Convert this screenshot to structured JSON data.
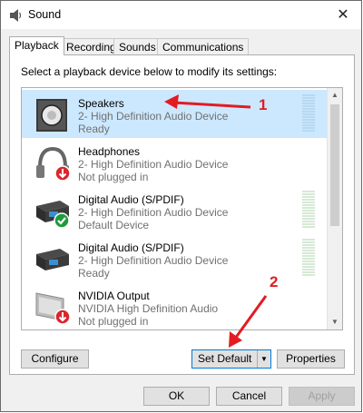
{
  "window": {
    "title": "Sound",
    "close_label": "✕"
  },
  "tabs": [
    {
      "label": "Playback"
    },
    {
      "label": "Recording"
    },
    {
      "label": "Sounds"
    },
    {
      "label": "Communications"
    }
  ],
  "instructions": "Select a playback device below to modify its settings:",
  "devices": [
    {
      "name": "Speakers",
      "desc": "2- High Definition Audio Device",
      "status": "Ready",
      "icon": "speaker-icon",
      "selected": true
    },
    {
      "name": "Headphones",
      "desc": "2- High Definition Audio Device",
      "status": "Not plugged in",
      "icon": "headphones-icon",
      "badge": "down-arrow-badge"
    },
    {
      "name": "Digital Audio (S/PDIF)",
      "desc": "2- High Definition Audio Device",
      "status": "Default Device",
      "icon": "digital-audio-icon",
      "badge": "checkmark-badge"
    },
    {
      "name": "Digital Audio (S/PDIF)",
      "desc": "2- High Definition Audio Device",
      "status": "Ready",
      "icon": "digital-audio-icon"
    },
    {
      "name": "NVIDIA Output",
      "desc": "NVIDIA High Definition Audio",
      "status": "Not plugged in",
      "icon": "monitor-icon",
      "badge": "down-arrow-badge"
    }
  ],
  "buttons": {
    "configure": "Configure",
    "set_default": "Set Default",
    "properties": "Properties",
    "ok": "OK",
    "cancel": "Cancel",
    "apply": "Apply"
  },
  "annotations": {
    "one": "1",
    "two": "2"
  },
  "colors": {
    "selected_row": "#cce8ff",
    "annotation_red": "#e31b23",
    "default_check": "#1e9b3a"
  }
}
